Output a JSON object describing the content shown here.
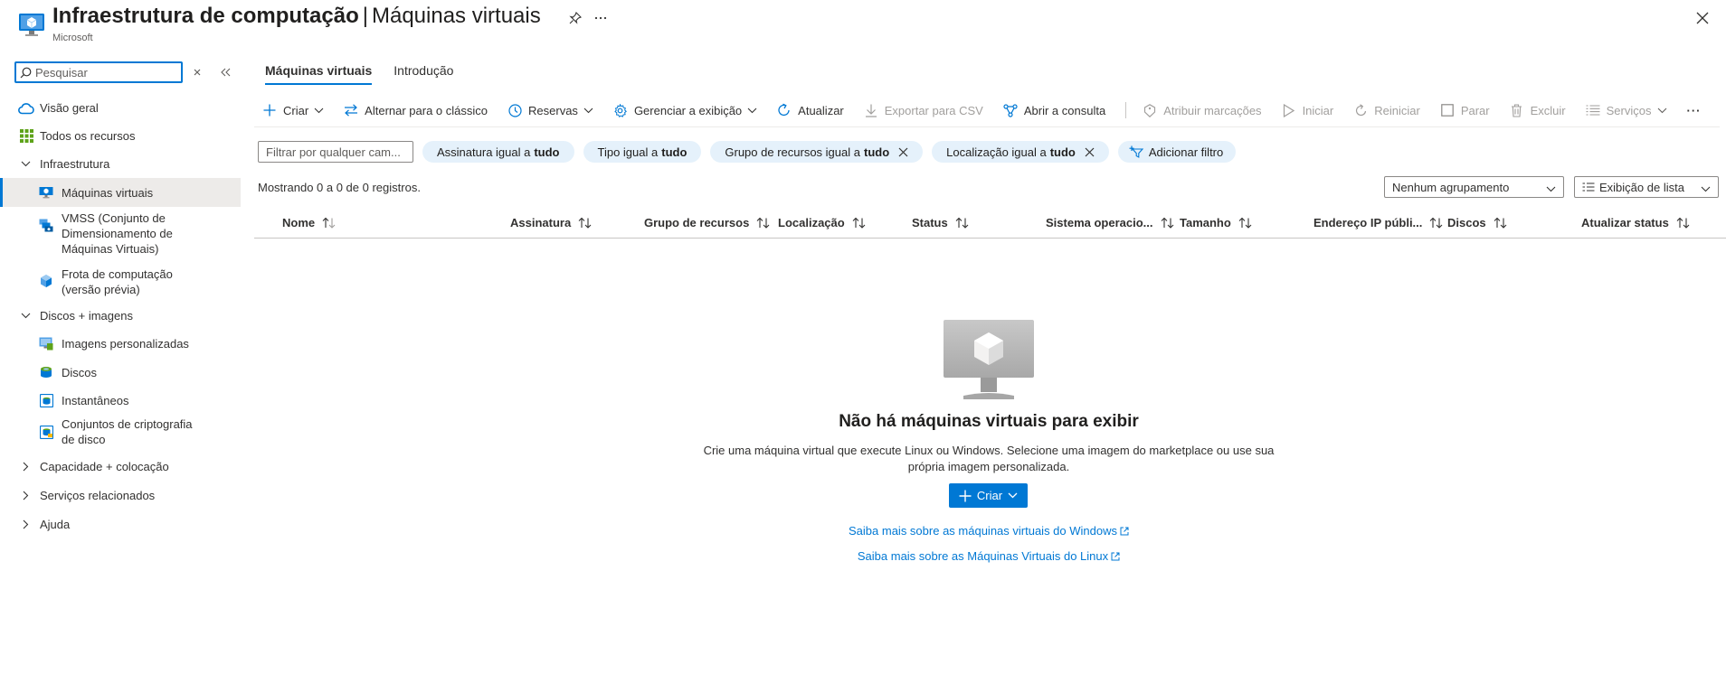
{
  "header": {
    "title_main": "Infraestrutura de computação",
    "title_separator": "|",
    "title_sub": "Máquinas virtuais",
    "org": "Microsoft",
    "icons": [
      "vm-blade-icon",
      "pin-icon",
      "more-icon",
      "close-icon"
    ]
  },
  "sidebar": {
    "search_placeholder": "Pesquisar",
    "items": [
      {
        "label": "Visão geral",
        "icon": "cloud-icon"
      },
      {
        "label": "Todos os recursos",
        "icon": "grid-icon"
      },
      {
        "label": "Infraestrutura",
        "state": "expanded"
      },
      {
        "label": "Máquinas virtuais",
        "icon": "vm-icon",
        "selected": true
      },
      {
        "label": "VMSS (Conjunto de Dimensionamento de Máquinas Virtuais)",
        "icon": "vmss-icon"
      },
      {
        "label": "Frota de computação (versão prévia)",
        "icon": "fleet-icon"
      },
      {
        "label": "Discos + imagens",
        "state": "expanded"
      },
      {
        "label": "Imagens personalizadas",
        "icon": "image-icon"
      },
      {
        "label": "Discos",
        "icon": "disk-icon"
      },
      {
        "label": "Instantâneos",
        "icon": "snapshot-icon"
      },
      {
        "label": "Conjuntos de criptografia de disco",
        "icon": "encryption-icon"
      },
      {
        "label": "Capacidade + colocação",
        "state": "collapsed"
      },
      {
        "label": "Serviços relacionados",
        "state": "collapsed"
      },
      {
        "label": "Ajuda",
        "state": "collapsed"
      }
    ]
  },
  "tabs": [
    {
      "label": "Máquinas virtuais",
      "active": true
    },
    {
      "label": "Introdução",
      "active": false
    }
  ],
  "toolbar": {
    "create": "Criar",
    "switch_classic": "Alternar para o clássico",
    "reservations": "Reservas",
    "manage_view": "Gerenciar a exibição",
    "refresh": "Atualizar",
    "export_csv": "Exportar para CSV",
    "open_query": "Abrir a consulta",
    "assign_tags": "Atribuir marcações",
    "start": "Iniciar",
    "restart": "Reiniciar",
    "stop": "Parar",
    "delete": "Excluir",
    "services": "Serviços",
    "more": "···"
  },
  "filters": {
    "placeholder": "Filtrar por qualquer cam...",
    "pills": [
      {
        "prefix": "Assinatura igual a",
        "value": "tudo",
        "removable": false
      },
      {
        "prefix": "Tipo igual a",
        "value": "tudo",
        "removable": false
      },
      {
        "prefix": "Grupo de recursos igual a",
        "value": "tudo",
        "removable": true
      },
      {
        "prefix": "Localização igual a",
        "value": "tudo",
        "removable": true
      }
    ],
    "add_filter": "Adicionar filtro"
  },
  "list": {
    "count_text": "Mostrando 0 a 0 de 0 registros.",
    "grouping": "Nenhum agrupamento",
    "view_mode": "Exibição de lista",
    "columns": [
      "Nome",
      "Assinatura",
      "Grupo de recursos",
      "Localização",
      "Status",
      "Sistema operacio...",
      "Tamanho",
      "Endereço IP públi...",
      "Discos",
      "Atualizar status"
    ]
  },
  "empty_state": {
    "title": "Não há máquinas virtuais para exibir",
    "description": "Crie uma máquina virtual que execute Linux ou Windows. Selecione uma imagem do marketplace ou use sua própria imagem personalizada.",
    "create_button": "Criar",
    "link_windows": "Saiba mais sobre as máquinas virtuais do Windows",
    "link_linux": "Saiba mais sobre as Máquinas Virtuais do Linux"
  },
  "colors": {
    "accent": "#0078d4",
    "pill_bg": "#e5f1fb",
    "selected_bg": "#edebe9"
  }
}
